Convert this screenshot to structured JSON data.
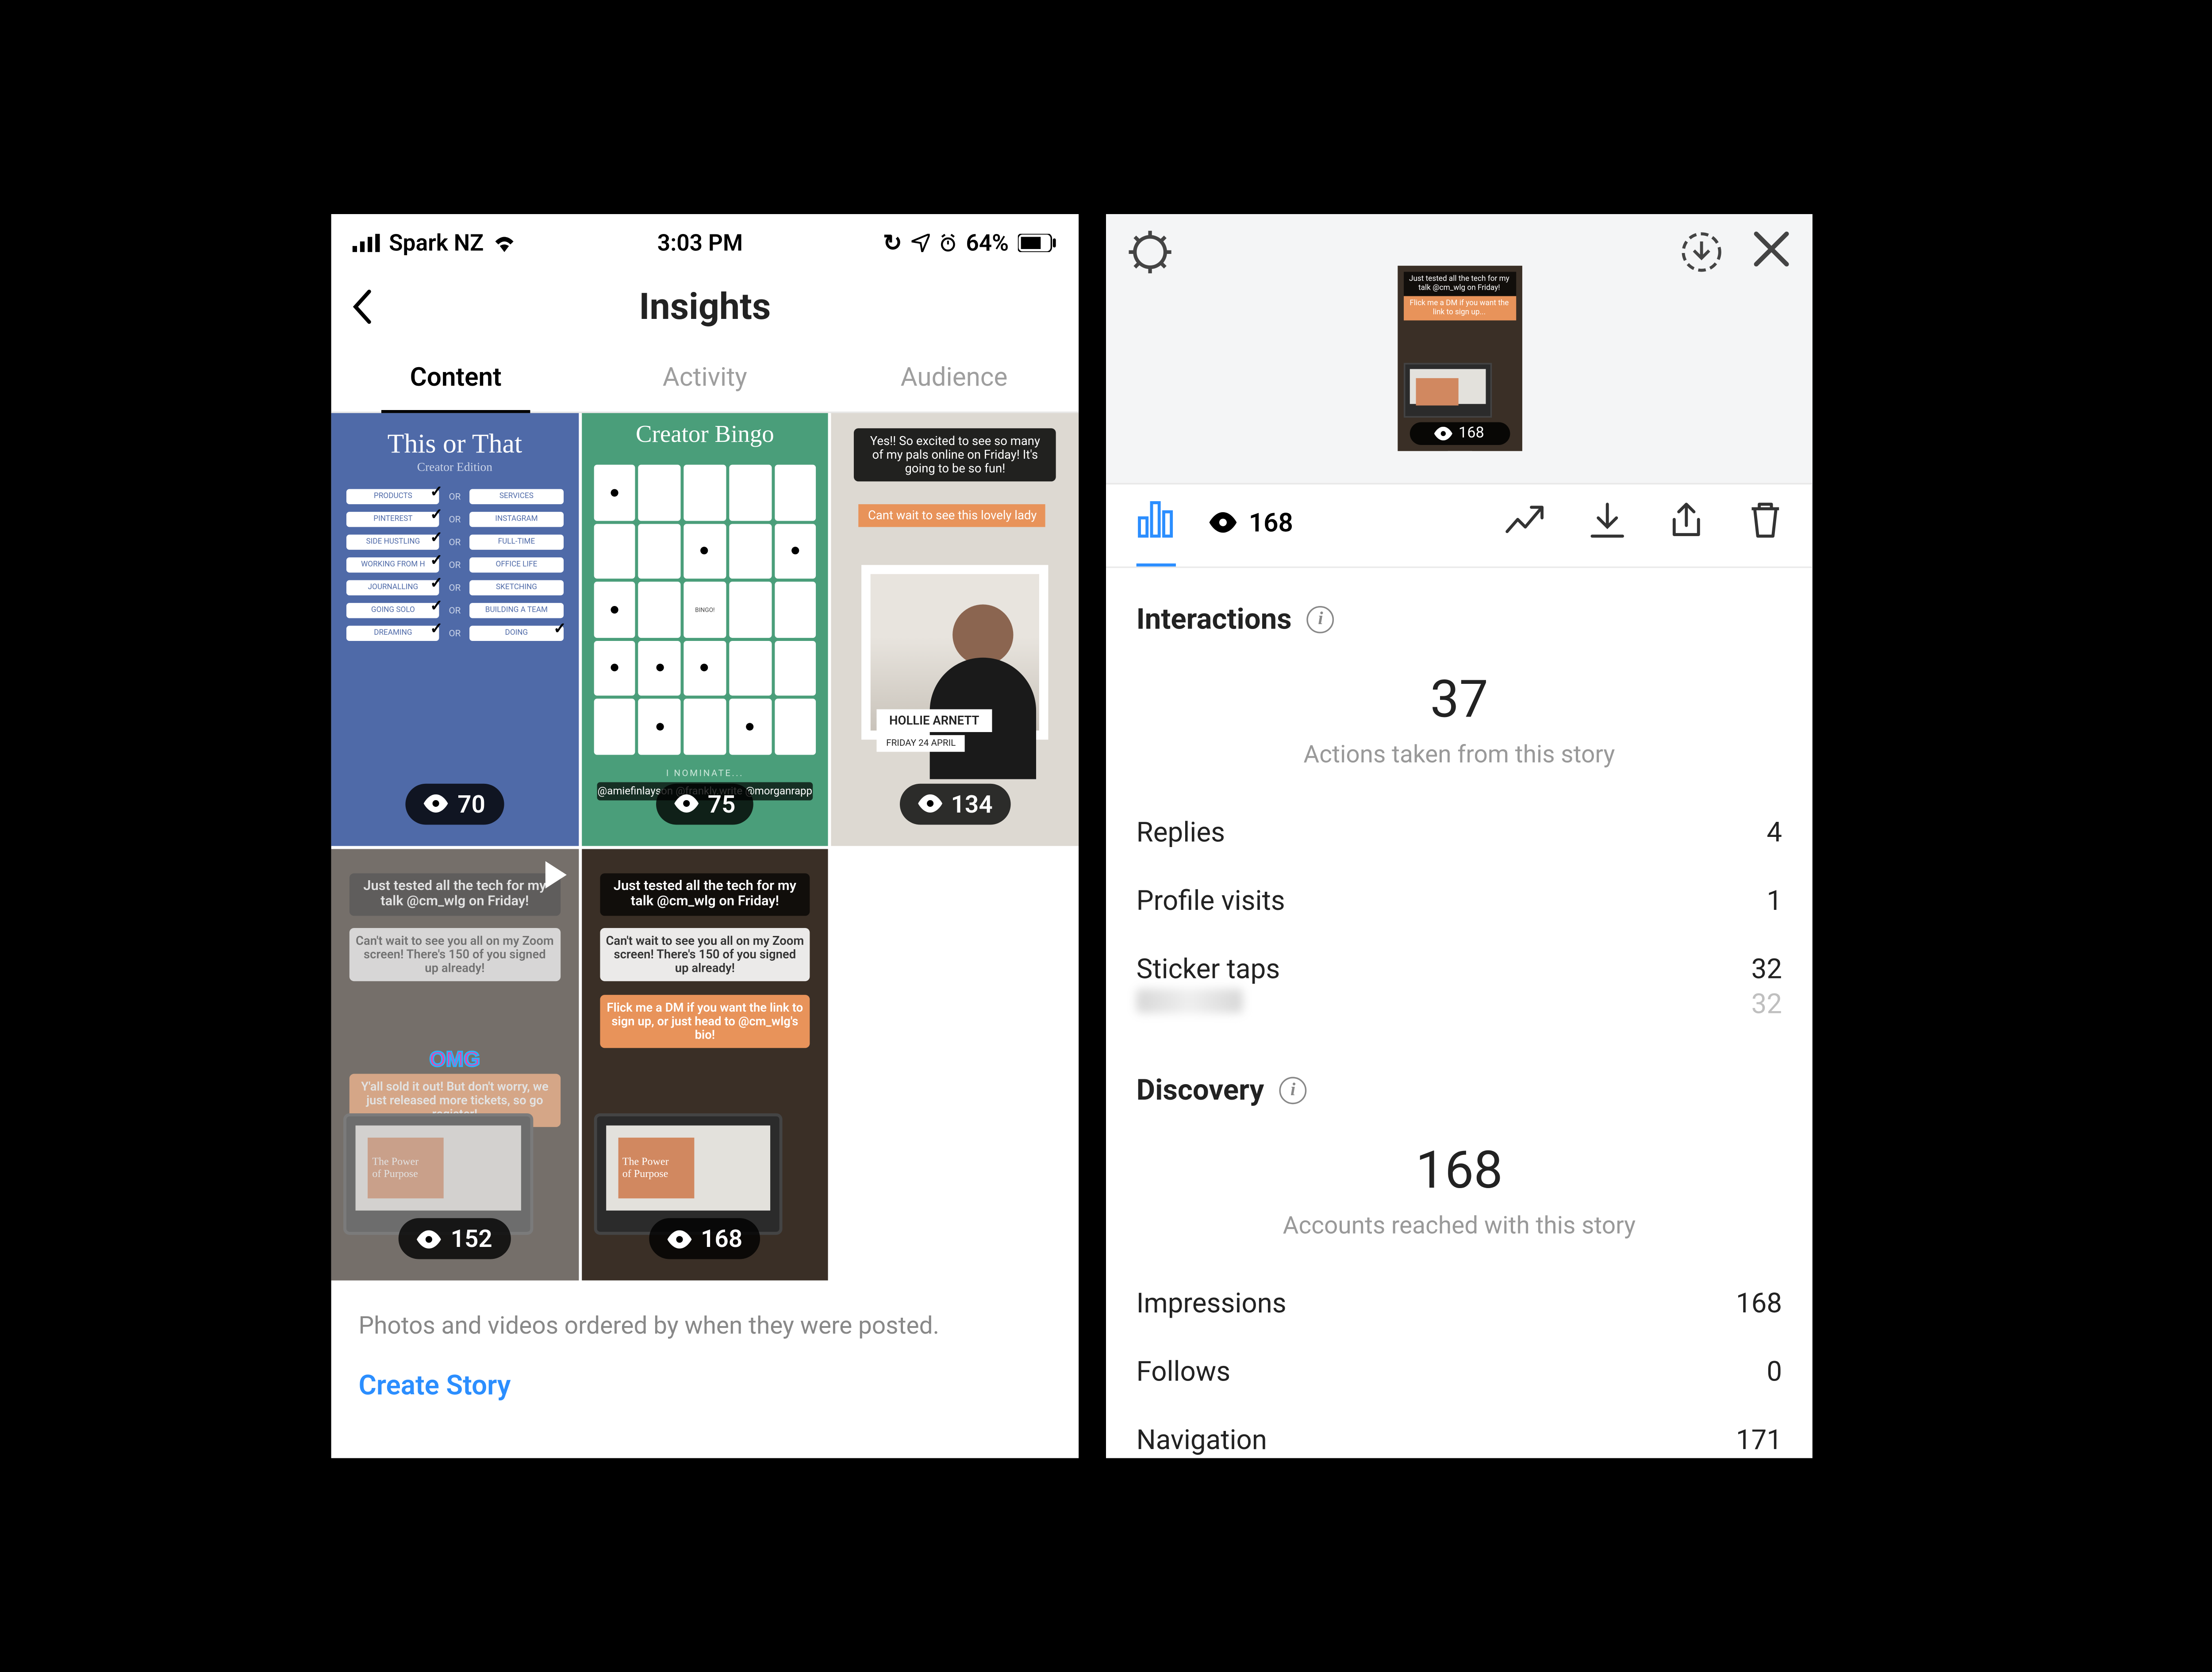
{
  "statusbar": {
    "carrier": "Spark NZ",
    "time": "3:03 PM",
    "battery": "64%"
  },
  "insights": {
    "title": "Insights",
    "tabs": {
      "content": "Content",
      "activity": "Activity",
      "audience": "Audience"
    },
    "thumbs": [
      {
        "title": "This or That",
        "sub": "Creator Edition",
        "views": "70"
      },
      {
        "title": "Creator Bingo",
        "nominate": "I NOMINATE...",
        "names": "@amiefinlayson @frankly.write @morganrapp",
        "views": "75"
      },
      {
        "top": "Yes!! So excited to see so many of my pals online on Friday! It's going to be so fun!",
        "orange": "Cant wait to see this lovely lady",
        "name": "HOLLIE ARNETT",
        "date": "FRIDAY 24 APRIL",
        "views": "134"
      },
      {
        "l1": "Just tested all the tech for my talk @cm_wlg on Friday!",
        "l2": "Can't wait to see you all on my Zoom screen! There's 150 of you signed up already!",
        "l3": "Y'all sold it out! But don't worry, we just released more tickets, so go register!",
        "omg": "OMG",
        "slide1": "The Power",
        "slide2": "of Purpose",
        "views": "152"
      },
      {
        "l1": "Just tested all the tech for my talk @cm_wlg on Friday!",
        "l2": "Can't wait to see you all on my Zoom screen! There's 150 of you signed up already!",
        "l3": "Flick me a DM if you want the link to sign up, or just head to @cm_wlg's bio!",
        "slide1": "The Power",
        "slide2": "of Purpose",
        "views": "168"
      }
    ],
    "caption": "Photos and videos ordered by when they were posted.",
    "create": "Create Story"
  },
  "detail": {
    "mini_views": "168",
    "tab_views": "168",
    "interactions": {
      "title": "Interactions",
      "total": "37",
      "sub": "Actions taken from this story",
      "rows": [
        {
          "label": "Replies",
          "value": "4"
        },
        {
          "label": "Profile visits",
          "value": "1"
        },
        {
          "label": "Sticker taps",
          "value": "32"
        },
        {
          "label_hidden": true,
          "value": "32"
        }
      ]
    },
    "discovery": {
      "title": "Discovery",
      "total": "168",
      "sub": "Accounts reached with this story",
      "rows": [
        {
          "label": "Impressions",
          "value": "168"
        },
        {
          "label": "Follows",
          "value": "0"
        },
        {
          "label": "Navigation",
          "value": "171"
        }
      ]
    }
  }
}
